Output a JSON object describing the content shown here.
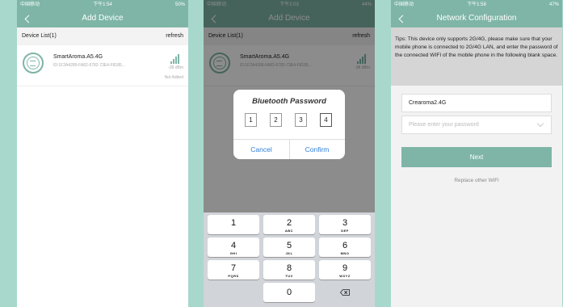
{
  "colors": {
    "accent": "#7eb5a6",
    "background": "#a8d8cc",
    "dialog_button": "#2f7fd9"
  },
  "screen1": {
    "status": {
      "carrier": "中国移动",
      "time": "下午1:54",
      "battery": "50%"
    },
    "title": "Add Device",
    "device_list_label": "Device List(1)",
    "refresh_label": "refresh",
    "device": {
      "name": "SmartAroma.A5.4G",
      "id": "ID:1F2A4289-FA82-6782-73E4-F8185...",
      "rssi": "-38 dBm",
      "status": "Not Added",
      "icon": "aroma-diffuser-icon"
    }
  },
  "screen2": {
    "status": {
      "carrier": "中国移动",
      "time": "下午2:03",
      "battery": "44%"
    },
    "title": "Add Device",
    "device_list_label": "Device List(1)",
    "refresh_label": "refresh",
    "device": {
      "name": "SmartAroma.A5.4G",
      "id": "ID:1F2A4289-FA82-6782-73E4-F8185...",
      "rssi": "-38 dBm"
    },
    "dialog": {
      "title": "Bluetooth Password",
      "digits": [
        "1",
        "2",
        "3",
        "4"
      ],
      "cancel": "Cancel",
      "confirm": "Confirm"
    },
    "keypad": {
      "keys": [
        {
          "num": "1",
          "letters": ""
        },
        {
          "num": "2",
          "letters": "ABC"
        },
        {
          "num": "3",
          "letters": "DEF"
        },
        {
          "num": "4",
          "letters": "GHI"
        },
        {
          "num": "5",
          "letters": "JKL"
        },
        {
          "num": "6",
          "letters": "MNO"
        },
        {
          "num": "7",
          "letters": "PQRS"
        },
        {
          "num": "8",
          "letters": "TUV"
        },
        {
          "num": "9",
          "letters": "WXYZ"
        },
        {
          "num": "0",
          "letters": ""
        }
      ]
    }
  },
  "screen3": {
    "status": {
      "carrier": "中国移动",
      "time": "下午1:58",
      "battery": "47%"
    },
    "title": "Network Configuration",
    "tips": "Tips: This device only supports 2G/4G, please make sure that your mobile phone is connected to 2G/4G LAN, and enter the password of the connected WIFI of the mobile phone in the following blank space.",
    "ssid": "Crearoma2.4G",
    "password_placeholder": "Please enter your password",
    "next_label": "Next",
    "replace_label": "Replace other WiFi"
  }
}
